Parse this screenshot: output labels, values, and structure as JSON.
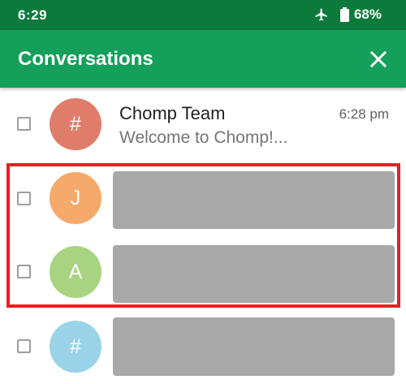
{
  "status_bar": {
    "time": "6:29",
    "battery": "68%"
  },
  "app_bar": {
    "title": "Conversations"
  },
  "conversations": [
    {
      "avatar_text": "#",
      "avatar_color": "#e07d6a",
      "title": "Chomp Team",
      "preview": "Welcome to Chomp!...",
      "time": "6:28 pm"
    },
    {
      "avatar_text": "J",
      "avatar_color": "#f5a96a"
    },
    {
      "avatar_text": "A",
      "avatar_color": "#a8d481"
    },
    {
      "avatar_text": "#",
      "avatar_color": "#9ad3e8"
    }
  ],
  "colors": {
    "status_bar": "#0b7a3a",
    "app_bar": "#14a05a",
    "highlight": "#ed1c24",
    "placeholder": "#a8a8a8"
  }
}
